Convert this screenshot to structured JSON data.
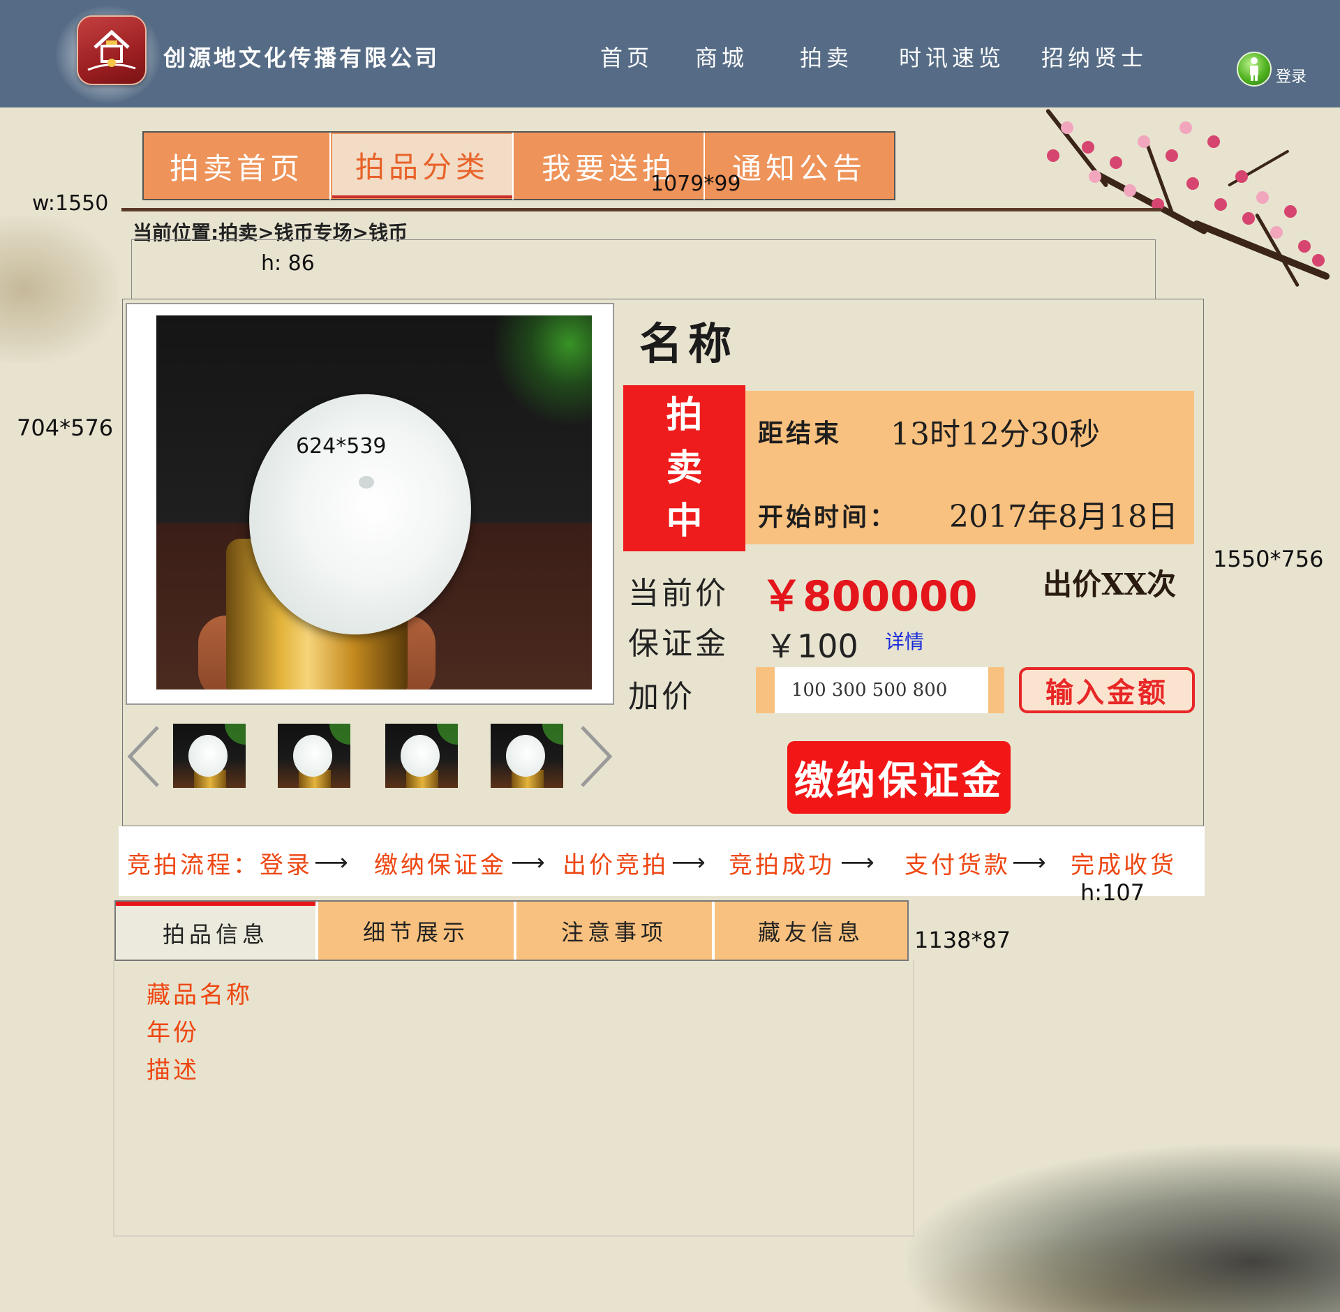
{
  "header": {
    "company": "创源地文化传播有限公司",
    "nav": [
      "首页",
      "商城",
      "拍卖",
      "时讯速览",
      "招纳贤士"
    ],
    "login": "登录"
  },
  "tabs": [
    "拍卖首页",
    "拍品分类",
    "我要送拍",
    "通知公告"
  ],
  "active_tab_index": 1,
  "annotations": {
    "tabbar_size": "1079*99",
    "width": "w:1550",
    "crumb_height": "h: 86",
    "image_frame_size": "704*576",
    "image_size": "624*539",
    "panel_size": "1550*756",
    "process_height": "h:107",
    "detail_tabs_size": "1138*87"
  },
  "breadcrumb": "当前位置:拍卖>钱币专场>钱币",
  "product": {
    "name": "名称",
    "status": [
      "拍",
      "卖",
      "中"
    ],
    "end_label": "距结束",
    "end_value": "13时12分30秒",
    "start_label": "开始时间：",
    "start_value": "2017年8月18日",
    "current_price_label": "当前价",
    "current_price": "￥800000",
    "bid_count": "出价XX次",
    "deposit_label": "保证金",
    "deposit": "￥100",
    "detail_link": "详情",
    "add_label": "加价",
    "add_options": "100 300 500 800",
    "enter_amount": "输入金额",
    "pay_deposit": "缴纳保证金"
  },
  "process": {
    "steps": [
      "竞拍流程：登录",
      "缴纳保证金",
      "出价竞拍",
      "竞拍成功",
      "支付货款",
      "完成收货"
    ],
    "arrow": "⟶"
  },
  "detail_tabs": [
    "拍品信息",
    "细节展示",
    "注意事项",
    "藏友信息"
  ],
  "active_detail_tab_index": 0,
  "detail_lines": [
    "藏品名称",
    "年份",
    "描述"
  ],
  "colors": {
    "header": "#566c86",
    "tab": "#ee9359",
    "accent_red": "#ee1c1c",
    "panel_orange": "#f9c17f",
    "process_text": "#ee4611",
    "background": "#e7e3cf"
  }
}
